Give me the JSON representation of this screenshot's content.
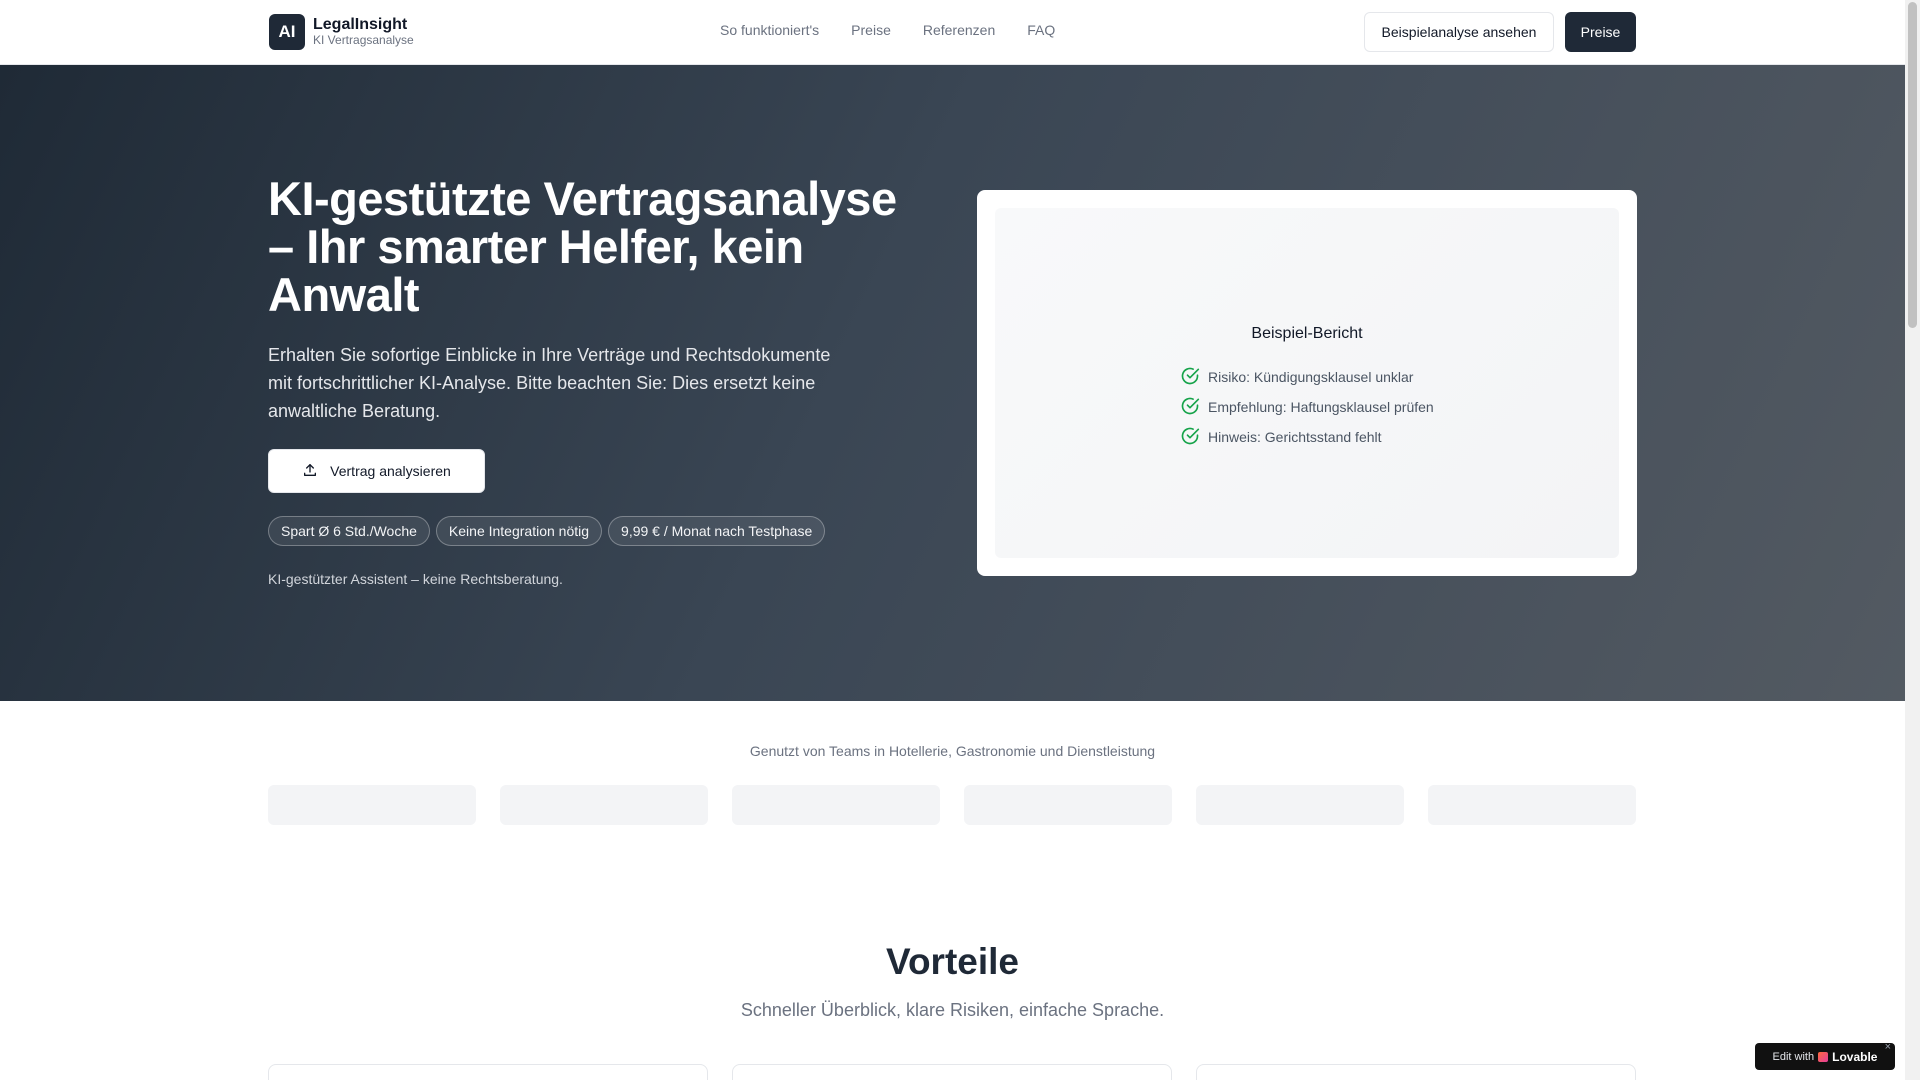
{
  "header": {
    "logo_text": "AI",
    "brand_name": "LegalInsight",
    "brand_sub": "KI Vertragsanalyse",
    "nav": [
      {
        "label": "So funktioniert's"
      },
      {
        "label": "Preise"
      },
      {
        "label": "Referenzen"
      },
      {
        "label": "FAQ"
      }
    ],
    "btn_example": "Beispielanalyse ansehen",
    "btn_pricing": "Preise"
  },
  "hero": {
    "title": "KI-gestützte Vertragsanalyse – Ihr smarter Helfer, kein Anwalt",
    "description": "Erhalten Sie sofortige Einblicke in Ihre Verträge und Rechtsdokumente mit fortschrittlicher KI-Analyse. Bitte beachten Sie: Dies ersetzt keine anwaltliche Beratung.",
    "cta": "Vertrag analysieren",
    "pills": [
      "Spart Ø 6 Std./Woche",
      "Keine Integration nötig",
      "9,99 € / Monat nach Testphase"
    ],
    "note": "KI-gestützter Assistent – keine Rechtsberatung.",
    "report": {
      "title": "Beispiel-Bericht",
      "items": [
        "Risiko: Kündigungsklausel unklar",
        "Empfehlung: Haftungsklausel prüfen",
        "Hinweis: Gerichtsstand fehlt"
      ]
    }
  },
  "trusted": {
    "label": "Genutzt von Teams in Hotellerie, Gastronomie und Dienstleistung"
  },
  "benefits": {
    "title": "Vorteile",
    "subtitle": "Schneller Überblick, klare Risiken, einfache Sprache."
  },
  "badge": {
    "prefix": "Edit with",
    "brand": "Lovable",
    "close": "×"
  },
  "colors": {
    "primary": "#1f2937",
    "check": "#16a34a"
  }
}
